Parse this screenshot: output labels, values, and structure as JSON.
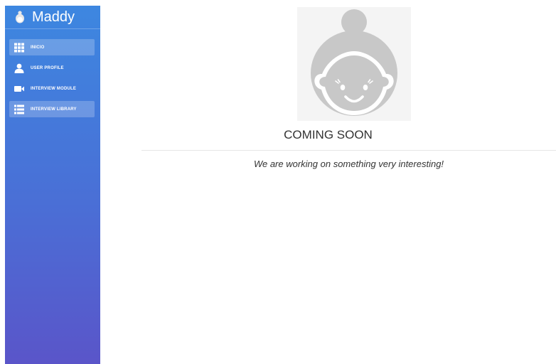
{
  "sidebar": {
    "brand": {
      "name": "Maddy",
      "icon": "woman-avatar-icon"
    },
    "items": [
      {
        "label": "INICIO",
        "icon": "grid-icon",
        "active": true
      },
      {
        "label": "USER PROFILE",
        "icon": "user-icon",
        "active": false
      },
      {
        "label": "INTERVIEW MODULE",
        "icon": "video-camera-icon",
        "active": false
      },
      {
        "label": "INTERVIEW LIBRARY",
        "icon": "list-icon",
        "active": true
      }
    ]
  },
  "main": {
    "illustration": "woman-avatar-icon",
    "title": "COMING SOON",
    "subtitle": "We are working on something very interesting!"
  },
  "colors": {
    "sidebar_top": "#3d87e0",
    "sidebar_bottom": "#5a55c9",
    "avatar_gray": "#c8c8c8"
  }
}
